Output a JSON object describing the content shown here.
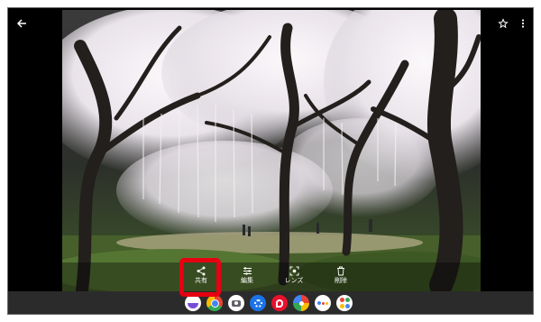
{
  "viewer": {
    "back_icon": "arrow-back-icon",
    "favorite_icon": "star-outline-icon",
    "more_icon": "more-vert-icon"
  },
  "actions": [
    {
      "label": "共有",
      "icon": "share-icon"
    },
    {
      "label": "編集",
      "icon": "edit-sliders-icon"
    },
    {
      "label": "レンズ",
      "icon": "lens-icon"
    },
    {
      "label": "削除",
      "icon": "trash-icon"
    }
  ],
  "dock": {
    "apps": [
      "app-1",
      "chrome-icon",
      "camera-icon",
      "settings-icon",
      "app-red",
      "photos-icon",
      "assistant-icon",
      "app-grid-icon"
    ]
  },
  "colors": {
    "highlight": "#e60012",
    "blossom": "#f2eff2",
    "grass": "#4c6a2d"
  }
}
